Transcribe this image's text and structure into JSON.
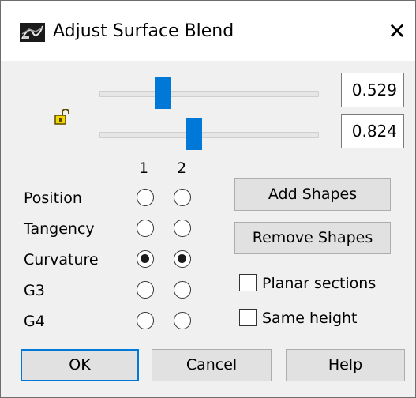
{
  "window": {
    "title": "Adjust Surface Blend",
    "close_label": "✕"
  },
  "sliders": [
    {
      "value_text": "0.529",
      "value": 0.529
    },
    {
      "value_text": "0.824",
      "value": 0.824
    }
  ],
  "columns": [
    "1",
    "2"
  ],
  "continuity": {
    "rows": [
      {
        "label": "Position",
        "col1": false,
        "col2": false
      },
      {
        "label": "Tangency",
        "col1": false,
        "col2": false
      },
      {
        "label": "Curvature",
        "col1": true,
        "col2": true
      },
      {
        "label": "G3",
        "col1": false,
        "col2": false
      },
      {
        "label": "G4",
        "col1": false,
        "col2": false
      }
    ]
  },
  "shape_buttons": {
    "add": "Add Shapes",
    "remove": "Remove Shapes"
  },
  "options": {
    "planar_sections": {
      "label": "Planar sections",
      "checked": false
    },
    "same_height": {
      "label": "Same height",
      "checked": false
    }
  },
  "footer": {
    "ok": "OK",
    "cancel": "Cancel",
    "help": "Help"
  },
  "colors": {
    "accent": "#0078d7"
  },
  "icons": {
    "app": "surface-blend-icon",
    "lock": "lock-unlocked-icon"
  }
}
